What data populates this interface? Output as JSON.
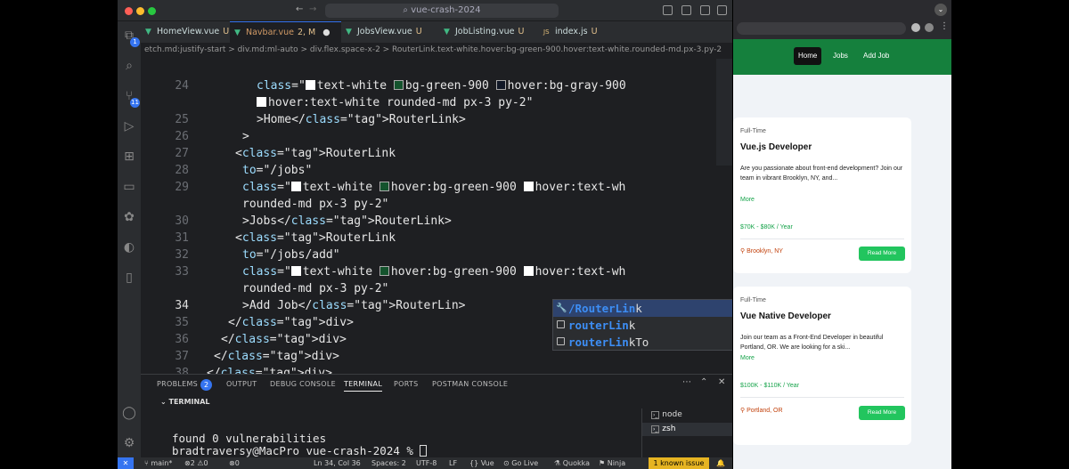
{
  "window": {
    "search": "vue-crash-2024"
  },
  "tabs": [
    {
      "label": "HomeView.vue",
      "status": "U"
    },
    {
      "label": "Navbar.vue",
      "status": "2, M"
    },
    {
      "label": "JobsView.vue",
      "status": "U"
    },
    {
      "label": "JobListing.vue",
      "status": "U"
    },
    {
      "label": "index.js",
      "status": "U"
    }
  ],
  "breadcrumb": "etch.md:justify-start  >  div.md:ml-auto  >  div.flex.space-x-2  >  RouterLink.text-white.hover:bg-green-900.hover:text-white.rounded-md.px-3.py-2",
  "editor": {
    "lines": [
      {
        "n": "",
        "t": "  "
      },
      {
        "n": "24",
        "t": "class=\"■text-white ▣bg-green-900 ▢hover:bg-gray-900"
      },
      {
        "n": "",
        "t": "■hover:text-white rounded-md px-3 py-2\""
      },
      {
        "n": "25",
        "t": ">Home</RouterLink>"
      },
      {
        "n": "26",
        "t": ">"
      },
      {
        "n": "27",
        "t": "<RouterLink"
      },
      {
        "n": "28",
        "t": "to=\"/jobs\""
      },
      {
        "n": "29",
        "t": "class=\"■text-white ▣hover:bg-green-900 ■hover:text-wh"
      },
      {
        "n": "",
        "t": "rounded-md px-3 py-2\""
      },
      {
        "n": "30",
        "t": ">Jobs</RouterLink>"
      },
      {
        "n": "31",
        "t": "<RouterLink"
      },
      {
        "n": "32",
        "t": "to=\"/jobs/add\""
      },
      {
        "n": "33",
        "t": "class=\"■text-white ▣hover:bg-green-900 ■hover:text-wh"
      },
      {
        "n": "",
        "t": "rounded-md px-3 py-2\""
      },
      {
        "n": "34",
        "t": ">Add Job</RouterLin>"
      },
      {
        "n": "35",
        "t": "</div>"
      },
      {
        "n": "36",
        "t": "</div>"
      },
      {
        "n": "37",
        "t": "</div>"
      },
      {
        "n": "38",
        "t": "</div>"
      }
    ]
  },
  "suggest": [
    {
      "match": "/RouterLin",
      "rest": "k",
      "detail": ""
    },
    {
      "match": "routerLin",
      "rest": "k",
      "detail": "routerLink"
    },
    {
      "match": "routerLin",
      "rest": "kTo",
      "detail": "routerLinkTo"
    }
  ],
  "panel": {
    "tabs": [
      "PROBLEMS",
      "OUTPUT",
      "DEBUG CONSOLE",
      "TERMINAL",
      "PORTS",
      "POSTMAN CONSOLE"
    ],
    "problems_count": "2",
    "terminal_header": "TERMINAL",
    "terminal_lines": [
      "found 0 vulnerabilities",
      "bradtraversy@MacPro vue-crash-2024 % "
    ],
    "shells": [
      "node",
      "zsh"
    ]
  },
  "statusbar": {
    "branch": "main*",
    "errors": "⊗2 ⚠0",
    "sync": "⊗0",
    "pos": "Ln 34, Col 36",
    "spaces": "Spaces: 2",
    "enc": "UTF-8",
    "eol": "LF",
    "lang": "{} Vue",
    "live": "⊙ Go Live",
    "quokka": "Quokka",
    "ninja": "Ninja",
    "issue": "1 known issue"
  },
  "site": {
    "nav": [
      "Home",
      "Jobs",
      "Add Job"
    ],
    "jobs": [
      {
        "type": "Full-Time",
        "title": "Vue.js Developer",
        "desc": "Are you passionate about front-end development? Join our team in vibrant Brooklyn, NY, and...",
        "more": "More",
        "salary": "$70K - $80K / Year",
        "location": "Brooklyn, NY",
        "button": "Read More"
      },
      {
        "type": "Full-Time",
        "title": "Vue Native Developer",
        "desc": "Join our team as a Front-End Developer in beautiful Portland, OR. We are looking for a ski...",
        "more": "More",
        "salary": "$100K - $110K / Year",
        "location": "Portland, OR",
        "button": "Read More"
      }
    ]
  },
  "colors": {
    "accent": "#3574f0",
    "nav_green": "#15803d",
    "button_green": "#22c55e",
    "tag": "#ef596f"
  }
}
